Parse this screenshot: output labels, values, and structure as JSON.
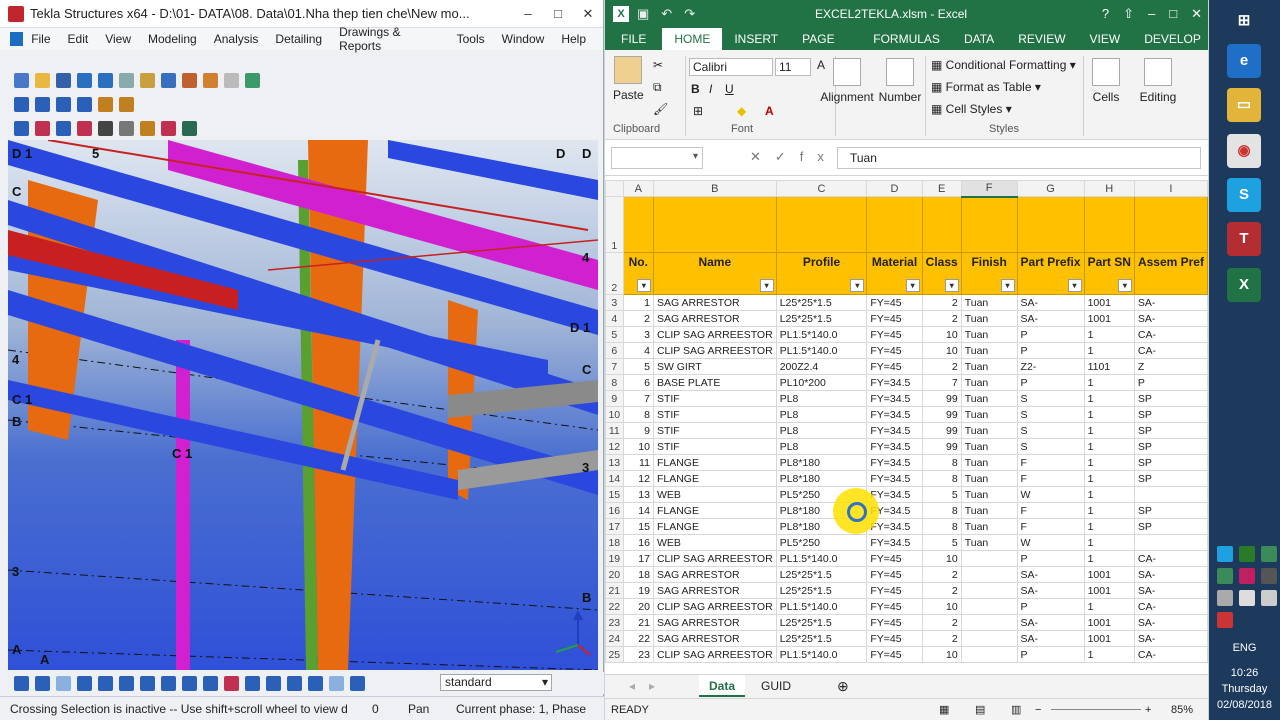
{
  "tekla": {
    "title": "Tekla Structures x64 - D:\\01- DATA\\08. Data\\01.Nha thep tien che\\New mo...",
    "menu": [
      "File",
      "Edit",
      "View",
      "Modeling",
      "Analysis",
      "Detailing",
      "Drawings & Reports",
      "Tools",
      "Window",
      "Help"
    ],
    "view_select": "standard",
    "grid_labels": [
      "D 1",
      "5",
      "D",
      "D",
      "C",
      "4",
      "D 1",
      "C",
      "4",
      "C 1",
      "B",
      "C 1",
      "3",
      "3",
      "B",
      "A",
      "A"
    ],
    "status": {
      "message": "Crossing Selection is inactive -- Use shift+scroll wheel to view d",
      "count": "0",
      "mode": "Pan",
      "phase": "Current phase: 1, Phase"
    }
  },
  "excel": {
    "title": "EXCEL2TEKLA.xlsm - Excel",
    "tabs": [
      "FILE",
      "HOME",
      "INSERT",
      "PAGE LAYOUT",
      "FORMULAS",
      "DATA",
      "REVIEW",
      "VIEW",
      "DEVELOP"
    ],
    "ribbon": {
      "paste": "Paste",
      "font_name": "Calibri",
      "font_size": "11",
      "alignment": "Alignment",
      "number": "Number",
      "conditional": "Conditional Formatting",
      "format_table": "Format as Table",
      "cell_styles": "Cell Styles",
      "cells": "Cells",
      "editing": "Editing",
      "groups": [
        "Clipboard",
        "Font",
        "Styles"
      ]
    },
    "formula_value": "Tuan",
    "columns": [
      "A",
      "B",
      "C",
      "D",
      "E",
      "F",
      "G",
      "H",
      "I"
    ],
    "headers": [
      "No.",
      "Name",
      "Profile",
      "Material",
      "Class",
      "Finish",
      "Part Prefix",
      "Part SN",
      "Assem Pref"
    ],
    "rows": [
      [
        "3",
        "1",
        "SAG ARRESTOR",
        "L25*25*1.5",
        "FY=45",
        "2",
        "Tuan",
        "SA-",
        "1001",
        "SA-"
      ],
      [
        "4",
        "2",
        "SAG ARRESTOR",
        "L25*25*1.5",
        "FY=45",
        "2",
        "Tuan",
        "SA-",
        "1001",
        "SA-"
      ],
      [
        "5",
        "3",
        "CLIP SAG ARREESTOR",
        "PL1.5*140.0",
        "FY=45",
        "10",
        "Tuan",
        "P",
        "1",
        "CA-"
      ],
      [
        "6",
        "4",
        "CLIP SAG ARREESTOR",
        "PL1.5*140.0",
        "FY=45",
        "10",
        "Tuan",
        "P",
        "1",
        "CA-"
      ],
      [
        "7",
        "5",
        "SW GIRT",
        "200Z2.4",
        "FY=45",
        "2",
        "Tuan",
        "Z2-",
        "1101",
        "Z"
      ],
      [
        "8",
        "6",
        "BASE PLATE",
        "PL10*200",
        "FY=34.5",
        "7",
        "Tuan",
        "P",
        "1",
        "P"
      ],
      [
        "9",
        "7",
        "STIF",
        "PL8",
        "FY=34.5",
        "99",
        "Tuan",
        "S",
        "1",
        "SP"
      ],
      [
        "10",
        "8",
        "STIF",
        "PL8",
        "FY=34.5",
        "99",
        "Tuan",
        "S",
        "1",
        "SP"
      ],
      [
        "11",
        "9",
        "STIF",
        "PL8",
        "FY=34.5",
        "99",
        "Tuan",
        "S",
        "1",
        "SP"
      ],
      [
        "12",
        "10",
        "STIF",
        "PL8",
        "FY=34.5",
        "99",
        "Tuan",
        "S",
        "1",
        "SP"
      ],
      [
        "13",
        "11",
        "FLANGE",
        "PL8*180",
        "FY=34.5",
        "8",
        "Tuan",
        "F",
        "1",
        "SP"
      ],
      [
        "14",
        "12",
        "FLANGE",
        "PL8*180",
        "FY=34.5",
        "8",
        "Tuan",
        "F",
        "1",
        "SP"
      ],
      [
        "15",
        "13",
        "WEB",
        "PL5*250",
        "FY=34.5",
        "5",
        "Tuan",
        "W",
        "1",
        ""
      ],
      [
        "16",
        "14",
        "FLANGE",
        "PL8*180",
        "FY=34.5",
        "8",
        "Tuan",
        "F",
        "1",
        "SP"
      ],
      [
        "17",
        "15",
        "FLANGE",
        "PL8*180",
        "FY=34.5",
        "8",
        "Tuan",
        "F",
        "1",
        "SP"
      ],
      [
        "18",
        "16",
        "WEB",
        "PL5*250",
        "FY=34.5",
        "5",
        "Tuan",
        "W",
        "1",
        ""
      ],
      [
        "19",
        "17",
        "CLIP SAG ARREESTOR",
        "PL1.5*140.0",
        "FY=45",
        "10",
        "",
        "P",
        "1",
        "CA-"
      ],
      [
        "20",
        "18",
        "SAG ARRESTOR",
        "L25*25*1.5",
        "FY=45",
        "2",
        "",
        "SA-",
        "1001",
        "SA-"
      ],
      [
        "21",
        "19",
        "SAG ARRESTOR",
        "L25*25*1.5",
        "FY=45",
        "2",
        "",
        "SA-",
        "1001",
        "SA-"
      ],
      [
        "22",
        "20",
        "CLIP SAG ARREESTOR",
        "PL1.5*140.0",
        "FY=45",
        "10",
        "",
        "P",
        "1",
        "CA-"
      ],
      [
        "23",
        "21",
        "SAG ARRESTOR",
        "L25*25*1.5",
        "FY=45",
        "2",
        "",
        "SA-",
        "1001",
        "SA-"
      ],
      [
        "24",
        "22",
        "SAG ARRESTOR",
        "L25*25*1.5",
        "FY=45",
        "2",
        "",
        "SA-",
        "1001",
        "SA-"
      ],
      [
        "25",
        "23",
        "CLIP SAG ARREESTOR",
        "PL1.5*140.0",
        "FY=45",
        "10",
        "",
        "P",
        "1",
        "CA-"
      ]
    ],
    "sheets": [
      "Data",
      "GUID"
    ],
    "status": "READY",
    "zoom": "85%"
  },
  "taskbar": {
    "language": "ENG",
    "time": "10:26",
    "day": "Thursday",
    "date": "02/08/2018"
  }
}
